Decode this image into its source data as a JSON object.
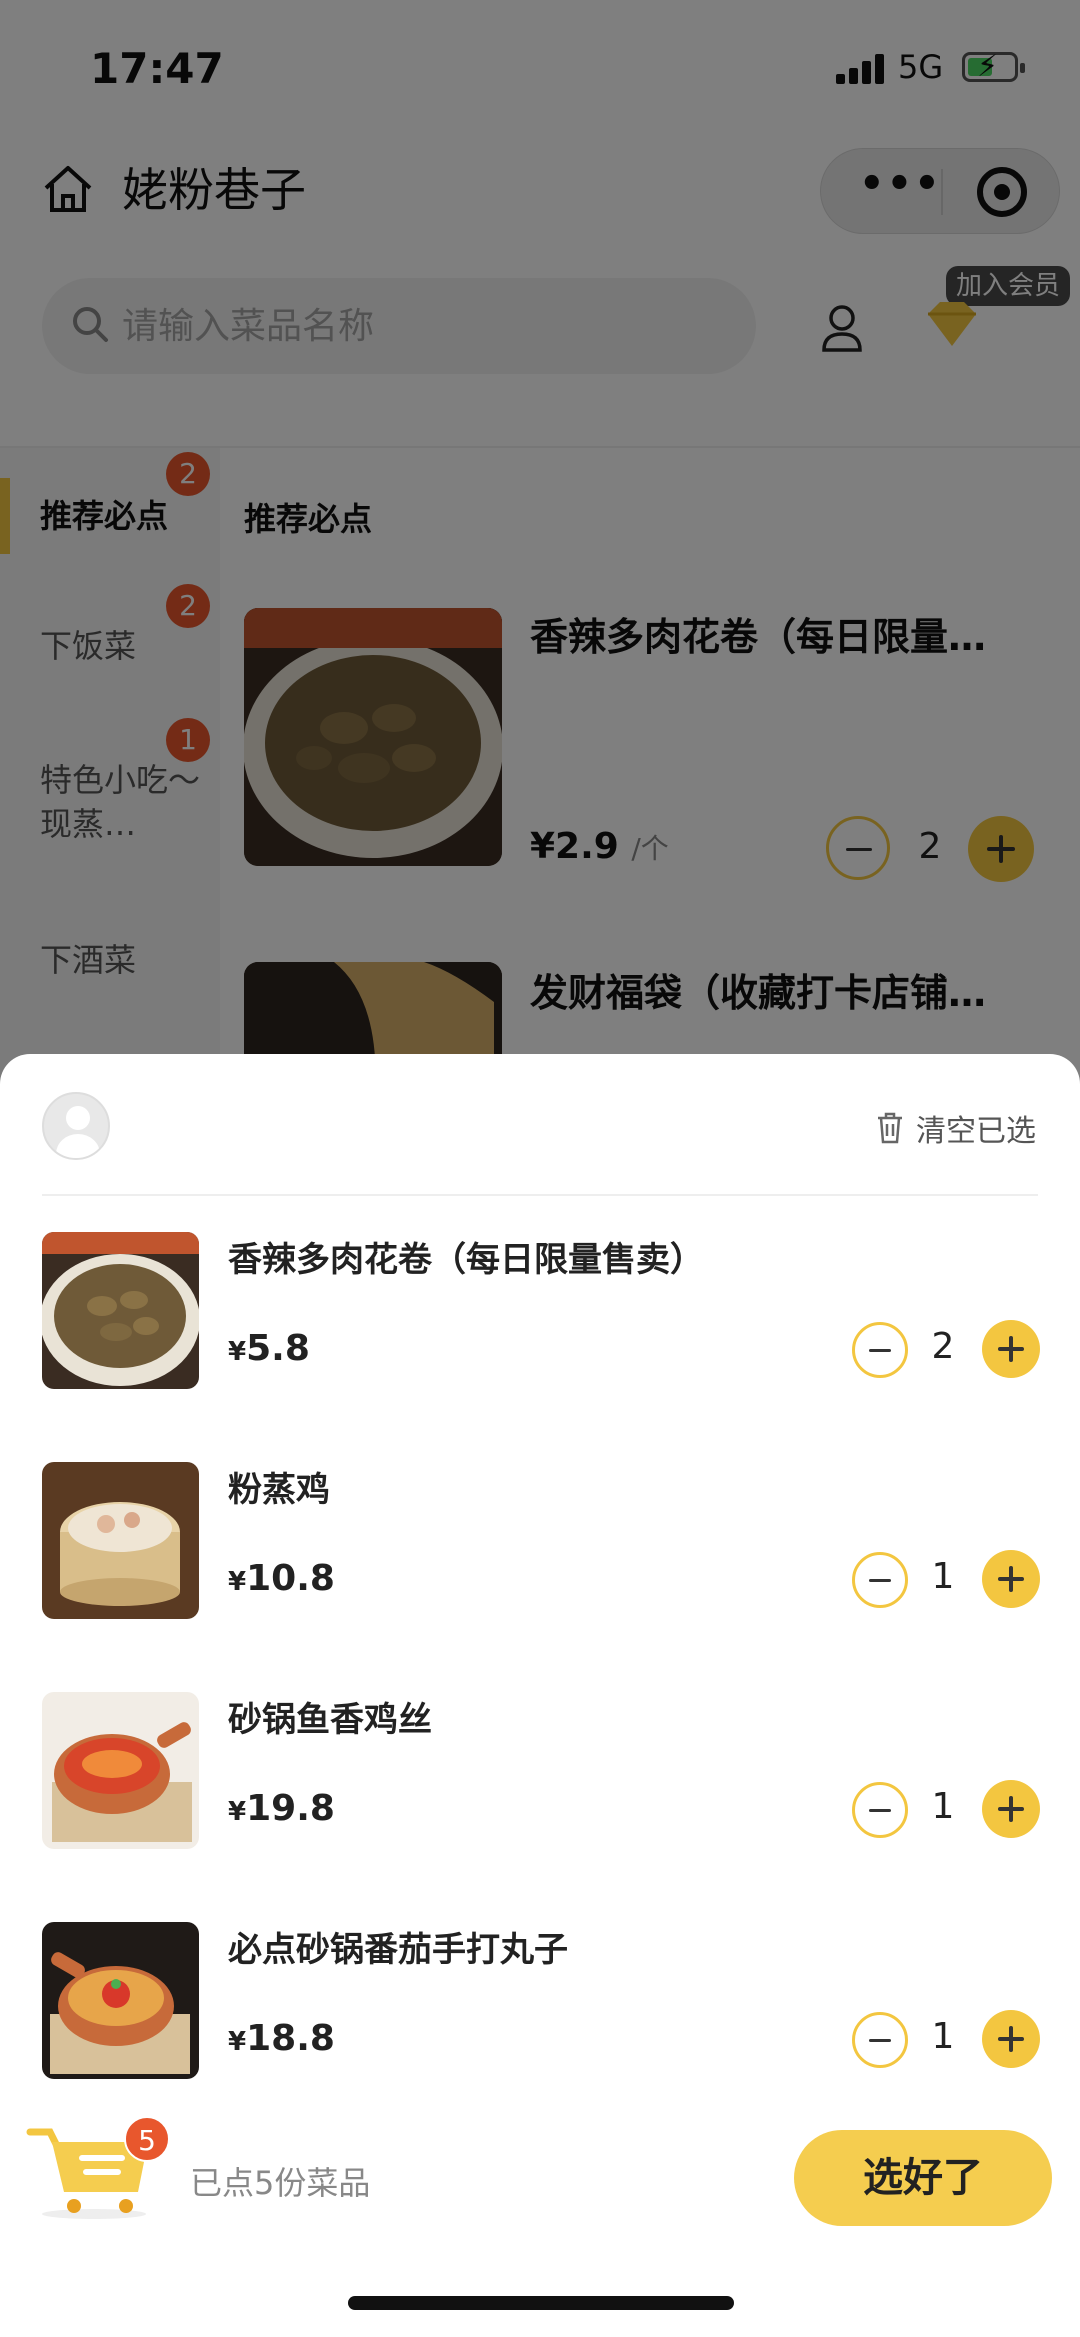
{
  "status_bar": {
    "time": "17:47",
    "network": "5G"
  },
  "header": {
    "store_name": "姥粉巷子"
  },
  "search": {
    "placeholder": "请输入菜品名称"
  },
  "member": {
    "badge_label": "加入会员"
  },
  "sidebar": {
    "categories": [
      {
        "label": "推荐必点",
        "badge": "2",
        "active": true
      },
      {
        "label": "下饭菜",
        "badge": "2"
      },
      {
        "label": "特色小吃～现蒸…",
        "badge": "1"
      },
      {
        "label": "下酒菜"
      }
    ]
  },
  "menu": {
    "section_title": "推荐必点",
    "items": [
      {
        "name": "香辣多肉花卷（每日限量…",
        "price": "¥2.9",
        "unit": "/个",
        "quantity": "2"
      },
      {
        "name": "发财福袋（收藏打卡店铺…"
      }
    ]
  },
  "cart_sheet": {
    "clear_label": "清空已选",
    "items": [
      {
        "name": "香辣多肉花卷（每日限量售卖）",
        "yen": "¥",
        "price": "5.8",
        "quantity": "2"
      },
      {
        "name": "粉蒸鸡",
        "yen": "¥",
        "price": "10.8",
        "quantity": "1"
      },
      {
        "name": "砂锅鱼香鸡丝",
        "yen": "¥",
        "price": "19.8",
        "quantity": "1"
      },
      {
        "name": "必点砂锅番茄手打丸子",
        "yen": "¥",
        "price": "18.8",
        "quantity": "1"
      }
    ]
  },
  "footer": {
    "cart_count": "5",
    "summary": "已点5份菜品",
    "confirm_label": "选好了"
  },
  "colors": {
    "accent": "#f3c640",
    "badge": "#e8572d"
  }
}
